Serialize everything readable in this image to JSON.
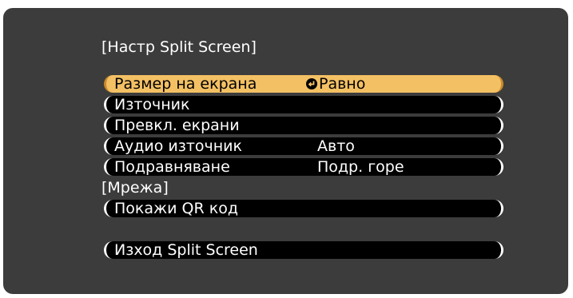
{
  "menu": {
    "title": "[Настр Split Screen]",
    "items": [
      {
        "label": "Размер на екрана",
        "value": "Равно"
      },
      {
        "label": "Източник",
        "value": ""
      },
      {
        "label": "Превкл. екрани",
        "value": ""
      },
      {
        "label": "Аудио източник",
        "value": "Авто"
      },
      {
        "label": "Подравняване",
        "value": "Подр. горе"
      }
    ],
    "section_network": "[Мрежа]",
    "qr_label": "Покажи QR код",
    "exit_label": "Изход Split Screen"
  },
  "colors": {
    "background": "#3c3c3c",
    "row": "#000000",
    "selected_row": "#f3c064",
    "text": "#ffffff"
  },
  "icons": {
    "selected_value_icon": "enter-icon"
  }
}
